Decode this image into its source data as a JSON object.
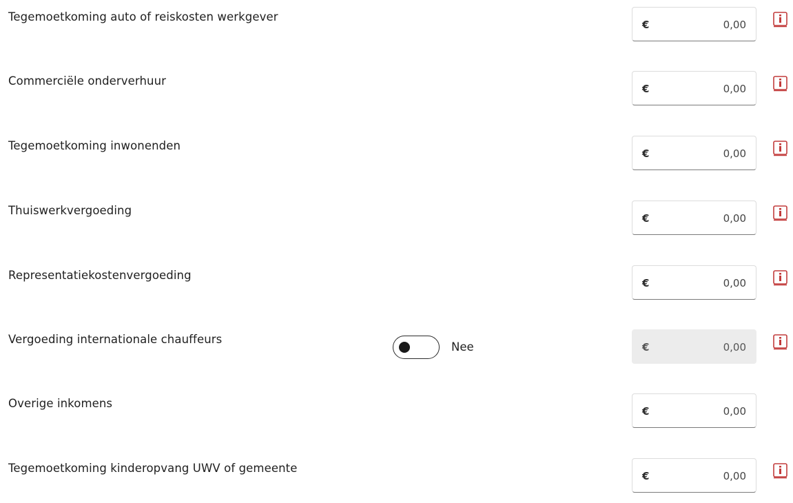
{
  "currency_symbol": "€",
  "rows": [
    {
      "label": "Tegemoetkoming auto of reiskosten werkgever",
      "amount": "0,00"
    },
    {
      "label": "Commerciële onderverhuur",
      "amount": "0,00"
    },
    {
      "label": "Tegemoetkoming inwonenden",
      "amount": "0,00"
    },
    {
      "label": "Thuiswerkvergoeding",
      "amount": "0,00"
    },
    {
      "label": "Representatiekostenvergoeding",
      "amount": "0,00"
    },
    {
      "label": "Vergoeding internationale chauffeurs",
      "amount": "0,00",
      "toggle_label": "Nee",
      "toggle_on": false
    },
    {
      "label": "Overige inkomens",
      "amount": "0,00"
    },
    {
      "label": "Tegemoetkoming kinderopvang UWV of gemeente",
      "amount": "0,00"
    }
  ],
  "info_icon_color": "#c0392b"
}
